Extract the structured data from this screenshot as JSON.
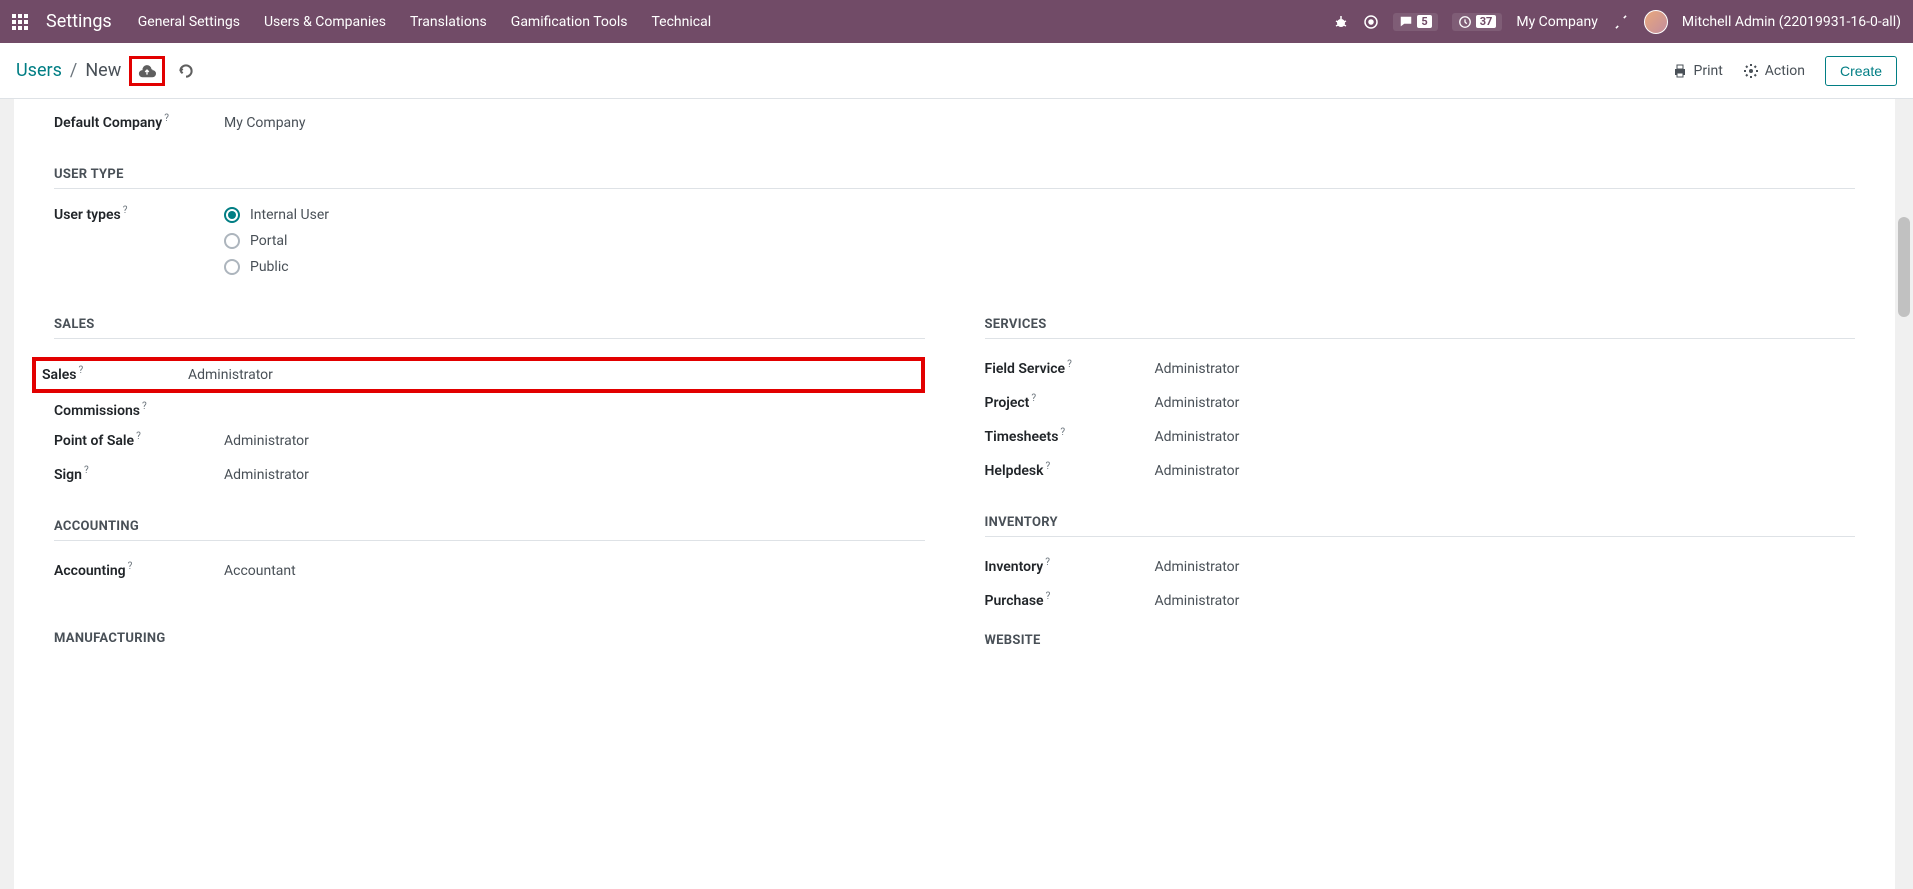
{
  "topbar": {
    "app_title": "Settings",
    "menu": [
      "General Settings",
      "Users & Companies",
      "Translations",
      "Gamification Tools",
      "Technical"
    ],
    "messages_badge": "5",
    "activities_badge": "37",
    "company": "My Company",
    "user": "Mitchell Admin (22019931-16-0-all)"
  },
  "breadcrumb": {
    "root": "Users",
    "current": "New",
    "print": "Print",
    "action": "Action",
    "create": "Create"
  },
  "form": {
    "default_company_label": "Default Company",
    "default_company_value": "My Company",
    "user_type_section": "USER TYPE",
    "user_types_label": "User types",
    "user_types": {
      "internal": "Internal User",
      "portal": "Portal",
      "public": "Public"
    },
    "sales_section": "SALES",
    "services_section": "SERVICES",
    "accounting_section": "ACCOUNTING",
    "inventory_section": "INVENTORY",
    "manufacturing_section": "MANUFACTURING",
    "website_section": "WEBSITE",
    "fields": {
      "sales": {
        "label": "Sales",
        "value": "Administrator"
      },
      "commissions": {
        "label": "Commissions",
        "value": ""
      },
      "pos": {
        "label": "Point of Sale",
        "value": "Administrator"
      },
      "sign": {
        "label": "Sign",
        "value": "Administrator"
      },
      "field_service": {
        "label": "Field Service",
        "value": "Administrator"
      },
      "project": {
        "label": "Project",
        "value": "Administrator"
      },
      "timesheets": {
        "label": "Timesheets",
        "value": "Administrator"
      },
      "helpdesk": {
        "label": "Helpdesk",
        "value": "Administrator"
      },
      "accounting": {
        "label": "Accounting",
        "value": "Accountant"
      },
      "inventory": {
        "label": "Inventory",
        "value": "Administrator"
      },
      "purchase": {
        "label": "Purchase",
        "value": "Administrator"
      }
    }
  }
}
